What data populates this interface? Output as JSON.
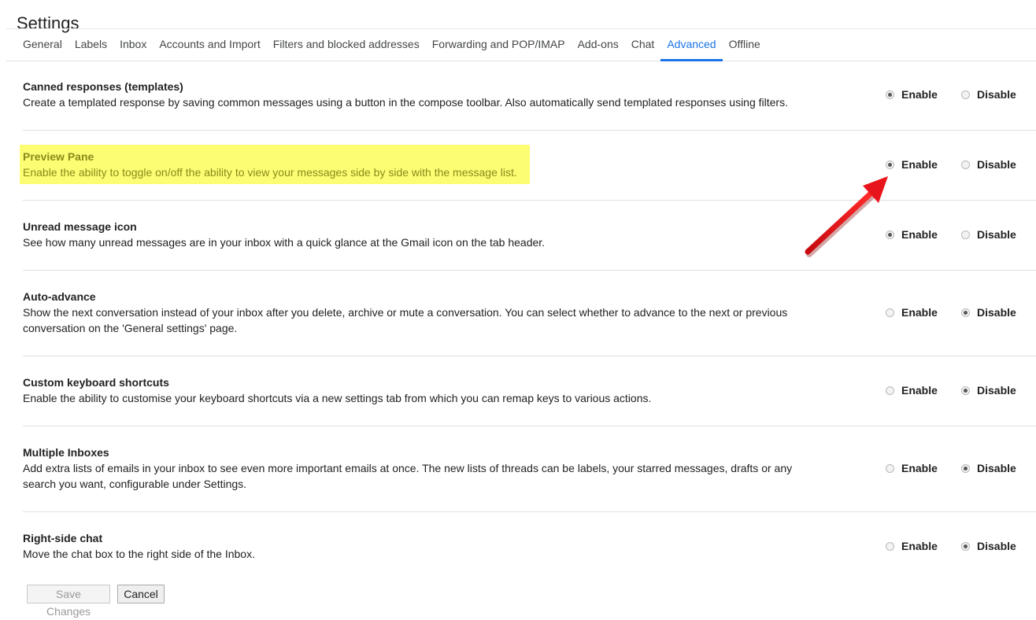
{
  "page": {
    "title": "Settings"
  },
  "tabs": [
    {
      "label": "General",
      "active": false
    },
    {
      "label": "Labels",
      "active": false
    },
    {
      "label": "Inbox",
      "active": false
    },
    {
      "label": "Accounts and Import",
      "active": false
    },
    {
      "label": "Filters and blocked addresses",
      "active": false
    },
    {
      "label": "Forwarding and POP/IMAP",
      "active": false
    },
    {
      "label": "Add-ons",
      "active": false
    },
    {
      "label": "Chat",
      "active": false
    },
    {
      "label": "Advanced",
      "active": true
    },
    {
      "label": "Offline",
      "active": false
    }
  ],
  "settings": [
    {
      "title": "Canned responses (templates)",
      "desc": "Create a templated response by saving common messages using a button in the compose toolbar. Also automatically send templated responses using filters.",
      "selected": "enable",
      "highlighted": false
    },
    {
      "title": "Preview Pane",
      "desc": "Enable the ability to toggle on/off the ability to view your messages side by side with the message list.",
      "selected": "enable",
      "highlighted": true
    },
    {
      "title": "Unread message icon",
      "desc": "See how many unread messages are in your inbox with a quick glance at the Gmail icon on the tab header.",
      "selected": "enable",
      "highlighted": false
    },
    {
      "title": "Auto-advance",
      "desc": "Show the next conversation instead of your inbox after you delete, archive or mute a conversation. You can select whether to advance to the next or previous conversation on the 'General settings' page.",
      "selected": "disable",
      "highlighted": false
    },
    {
      "title": "Custom keyboard shortcuts",
      "desc": "Enable the ability to customise your keyboard shortcuts via a new settings tab from which you can remap keys to various actions.",
      "selected": "disable",
      "highlighted": false
    },
    {
      "title": "Multiple Inboxes",
      "desc": "Add extra lists of emails in your inbox to see even more important emails at once. The new lists of threads can be labels, your starred messages, drafts or any search you want, configurable under Settings.",
      "selected": "disable",
      "highlighted": false
    },
    {
      "title": "Right-side chat",
      "desc": "Move the chat box to the right side of the Inbox.",
      "selected": "disable",
      "highlighted": false
    }
  ],
  "radio_labels": {
    "enable": "Enable",
    "disable": "Disable"
  },
  "buttons": {
    "save_label": "Save Changes",
    "cancel_label": "Cancel"
  },
  "colors": {
    "accent": "#1a73e8",
    "highlight": "#fdfd74",
    "arrow": "#e8141b"
  },
  "annotation": {
    "arrow_points_to": "preview-pane-enable-radio"
  }
}
